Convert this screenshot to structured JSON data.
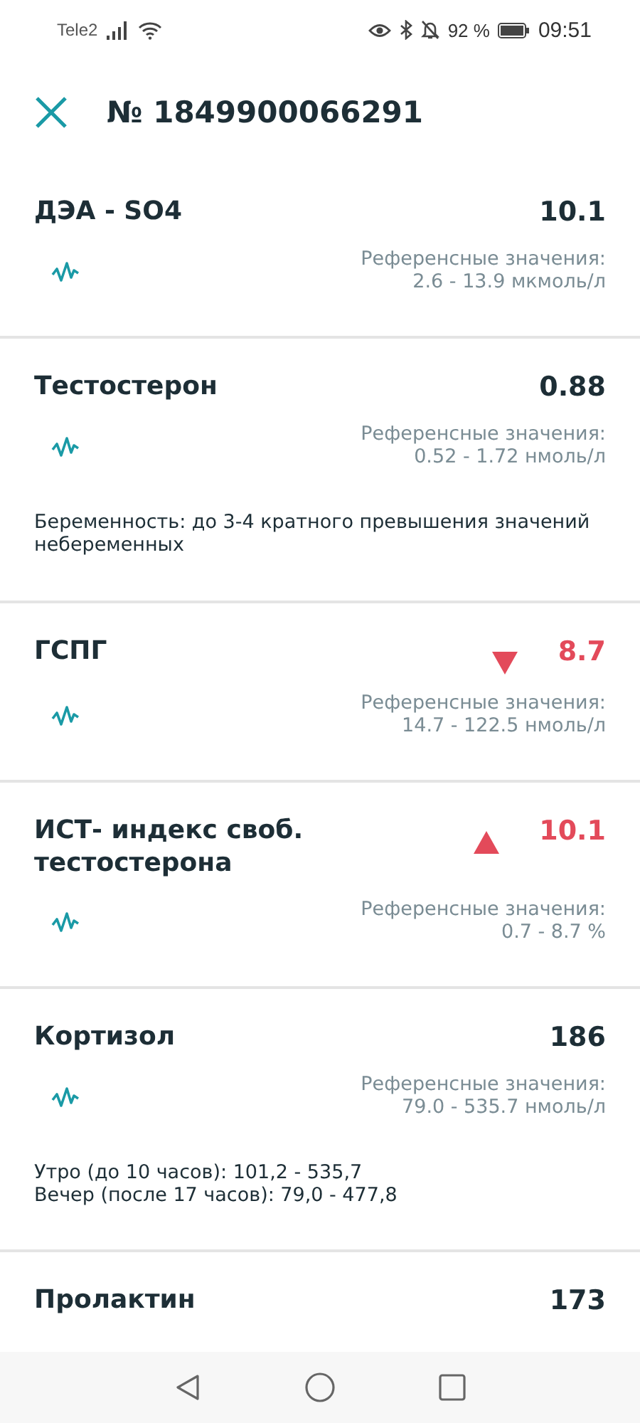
{
  "status_bar": {
    "carrier": "Tele2",
    "battery_percent": "92 %",
    "time": "09:51"
  },
  "header": {
    "title": "№ 1849900066291"
  },
  "results": [
    {
      "name": "ДЭА - SO4",
      "value": "10.1",
      "kind": "normal",
      "ref_label": "Референсные значения:",
      "ref_range": "2.6 - 13.9 мкмоль/л"
    },
    {
      "name": "Тестостерон",
      "value": "0.88",
      "kind": "normal",
      "ref_label": "Референсные значения:",
      "ref_range": "0.52 - 1.72 нмоль/л",
      "note": "Беременность: до 3-4 кратного превышения значений небеременных"
    },
    {
      "name": "ГСПГ",
      "value": "8.7",
      "kind": "low",
      "ref_label": "Референсные значения:",
      "ref_range": "14.7 - 122.5 нмоль/л"
    },
    {
      "name": "ИСТ- индекс своб. тестостерона",
      "value": "10.1",
      "kind": "high",
      "ref_label": "Референсные значения:",
      "ref_range": "0.7 - 8.7 %"
    },
    {
      "name": "Кортизол",
      "value": "186",
      "kind": "normal",
      "ref_label": "Референсные значения:",
      "ref_range": "79.0 - 535.7 нмоль/л",
      "note": "Утро (до 10 часов): 101,2 - 535,7\nВечер (после 17 часов): 79,0 - 477,8"
    },
    {
      "name": "Пролактин",
      "value": "173",
      "kind": "normal"
    }
  ]
}
